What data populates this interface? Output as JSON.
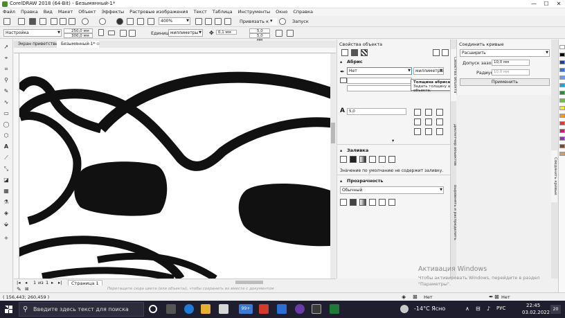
{
  "window": {
    "title": "CorelDRAW 2018 (64-Bit) - Безымянный-1*",
    "controls": [
      "—",
      "☐",
      "✕"
    ]
  },
  "menu": [
    "Файл",
    "Правка",
    "Вид",
    "Макет",
    "Объект",
    "Эффекты",
    "Растровые изображения",
    "Текст",
    "Таблица",
    "Инструменты",
    "Окно",
    "Справка"
  ],
  "toolbar": {
    "zoom": "400%",
    "snap": "Привязать к",
    "launch": "Запуск"
  },
  "propbar": {
    "preset": "Настройка",
    "width": "250,0 мм",
    "height": "300,0 мм",
    "units_label": "Единицы:",
    "units": "миллиметры",
    "nudge": "0,1 мм",
    "dup_x": "5,0 мм",
    "dup_y": "5,0 мм"
  },
  "doc_tabs": [
    "Экран приветствия",
    "Безымянный-1*"
  ],
  "page_nav": {
    "current": "1",
    "of": "из",
    "total": "1",
    "page_tab": "Страница 1"
  },
  "hint": "Перетащите сюда цвета (или объекты), чтобы сохранить их вместе с документом",
  "coords": "( 156,443; 260,459 )",
  "object_props": {
    "title": "Свойства объекта",
    "outline": {
      "header": "Абрис",
      "width_value": "Нет",
      "units": "миллиметры",
      "miter": "5,0"
    },
    "fill": {
      "header": "Заливка",
      "note": "Значение по умолчанию не содержит заливку."
    },
    "transparency": {
      "header": "Прозрачность",
      "mode": "Обычный"
    }
  },
  "tooltip": {
    "title": "Толщина абриса",
    "body": "Задать толщину абриса для объекта."
  },
  "join_curves": {
    "title": "Соединить кривые",
    "mode": "Расширить",
    "gap_label": "Допуск зазора:",
    "gap_value": "10,0 мм",
    "radius_label": "Радиус:",
    "radius_value": "10,0 мм",
    "apply": "Применить"
  },
  "side_tabs": [
    "Свойства объекта",
    "Диспетчер объектов",
    "Выровнять и распределить"
  ],
  "right_tabs": [
    "Соединить кривые"
  ],
  "palette_colors": [
    "#ffffff",
    "#000000",
    "#1f3f8f",
    "#3c6fd6",
    "#6a9be8",
    "#20a4d8",
    "#2a8a3a",
    "#6cc04a",
    "#f3e63a",
    "#f29b22",
    "#e33a2f",
    "#c21e6e",
    "#8a3aa8",
    "#7a4a2a",
    "#c8a070"
  ],
  "watermark": {
    "title": "Активация Windows",
    "body": "Чтобы активировать Windows, перейдите в раздел \"Параметры\"."
  },
  "statusbar": {
    "fill_state": "Нет",
    "outline_state": "Нет"
  },
  "taskbar": {
    "search_placeholder": "Введите здесь текст для поиска",
    "weather": "-14°C  Ясно",
    "lang": "РУС",
    "time": "22:45",
    "date": "03.02.2022",
    "badge_count": "99+",
    "notif_count": "20"
  }
}
